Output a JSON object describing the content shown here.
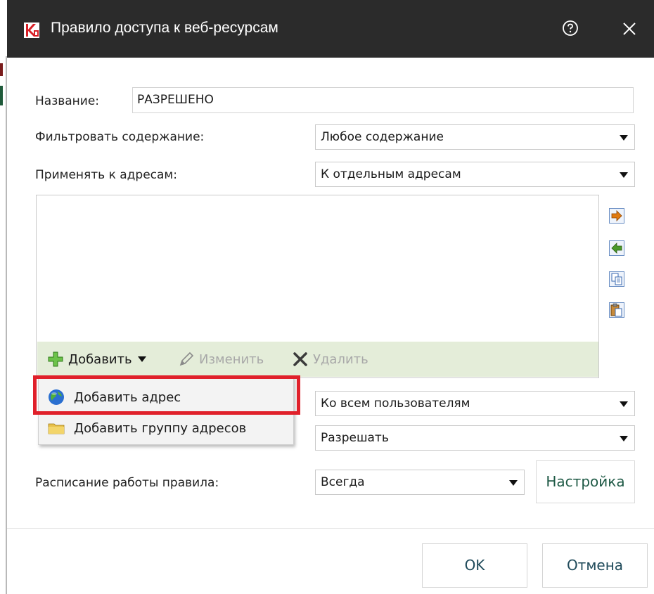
{
  "window": {
    "title": "Правило доступа к веб-ресурсам",
    "logo_icon": "kaspersky-logo-icon",
    "help_icon": "help-icon",
    "close_icon": "close-icon"
  },
  "form": {
    "name_label": "Название:",
    "name_value": "РАЗРЕШЕНО",
    "filter_label": "Фильтровать содержание:",
    "filter_value": "Любое содержание",
    "apply_label": "Применять к адресам:",
    "apply_value": "К отдельным адресам",
    "users_value": "Ко всем пользователям",
    "action_value": "Разрешать",
    "schedule_label": "Расписание работы правила:",
    "schedule_value": "Всегда",
    "settings_button": "Настройка"
  },
  "toolbar": {
    "add_label": "Добавить",
    "edit_label": "Изменить",
    "delete_label": "Удалить"
  },
  "dropdown": {
    "items": [
      {
        "label": "Добавить адрес",
        "icon": "globe-icon"
      },
      {
        "label": "Добавить группу адресов",
        "icon": "folder-icon"
      }
    ]
  },
  "side_icons": [
    "move-right-icon",
    "move-left-icon",
    "copy-icon",
    "paste-icon"
  ],
  "footer": {
    "ok_label": "OK",
    "cancel_label": "Отмена"
  },
  "colors": {
    "titlebar": "#2b2b2b",
    "toolbar_bg": "#e4edd9",
    "highlight": "#e0202a",
    "accent_green": "#1f5a46"
  }
}
